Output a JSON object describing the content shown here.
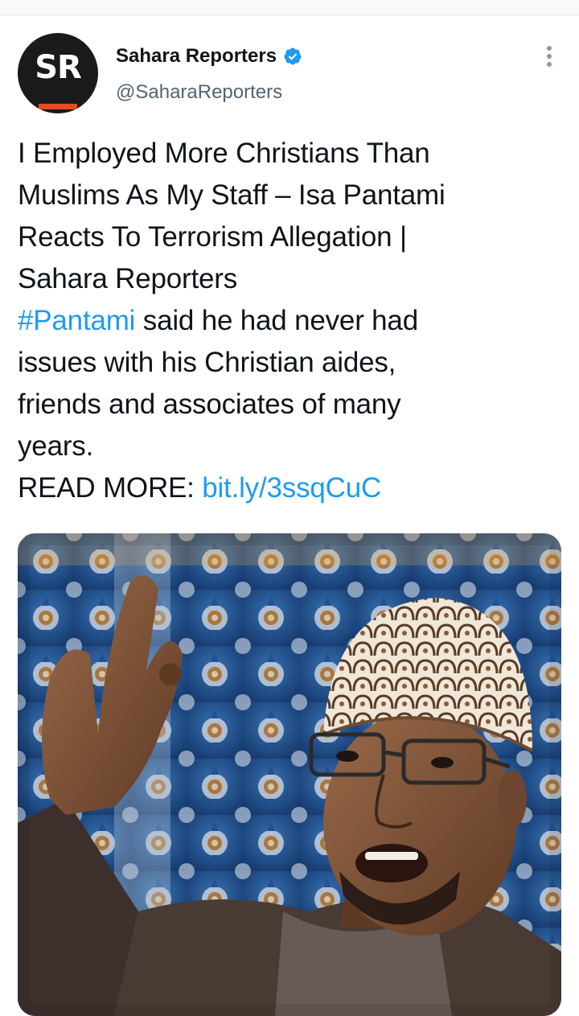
{
  "account": {
    "display_name": "Sahara Reporters",
    "handle": "@SaharaReporters",
    "avatar_text": "SR",
    "verified": true
  },
  "tweet": {
    "headline_lines": [
      "I Employed More Christians Than",
      "Muslims As My Staff – Isa Pantami",
      "Reacts To Terrorism Allegation |",
      "Sahara Reporters"
    ],
    "hashtag": "#Pantami",
    "body_line_1_rest": " said he had never had",
    "body_lines": [
      "issues with his Christian aides,",
      "friends and associates of many",
      "years."
    ],
    "read_more_label": "READ MORE: ",
    "link_text": "bit.ly/3ssqCuC"
  },
  "icons": {
    "verified": "verified-badge-icon",
    "more": "more-options-icon"
  },
  "colors": {
    "accent": "#1d9bf0",
    "text": "#0f1419",
    "secondary": "#536471",
    "brand_orange": "#e84c1e"
  }
}
